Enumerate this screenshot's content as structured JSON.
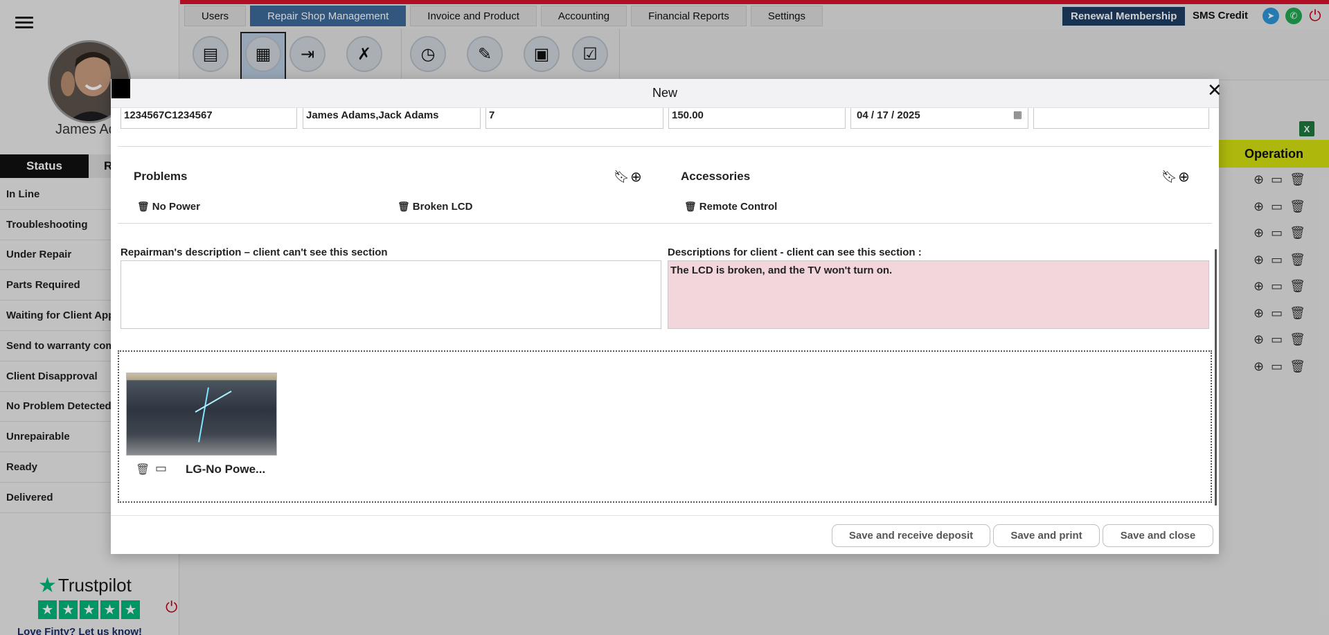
{
  "sidebar": {
    "user_name": "James Ada",
    "tabs": {
      "status": "Status",
      "other": "R"
    },
    "statuses": [
      "In Line",
      "Troubleshooting",
      "Under Repair",
      "Parts Required",
      "Waiting for Client App",
      "Send to warranty com",
      "Client Disapproval",
      "No Problem Detected",
      "Unrepairable",
      "Ready",
      "Delivered"
    ],
    "trustpilot": {
      "brand": "Trustpilot",
      "cta": "Love Finty? Let us know!"
    }
  },
  "nav": {
    "tabs": [
      "Users",
      "Repair Shop Management",
      "Invoice and Product",
      "Accounting",
      "Financial Reports",
      "Settings"
    ],
    "active": "Repair Shop Management",
    "renewal": "Renewal Membership",
    "sms_credit": "SMS Credit"
  },
  "table": {
    "operation_header": "Operation",
    "row_count": 8,
    "row_icons": [
      "add-circle-icon",
      "monitor-icon",
      "trash-icon"
    ]
  },
  "modal": {
    "title": "New",
    "fields": {
      "serial": "1234567C1234567",
      "client": "James Adams,Jack Adams",
      "count": "7",
      "price": "150.00",
      "date": "04 / 17 / 2025",
      "extra": ""
    },
    "problems": {
      "title": "Problems",
      "items": [
        "No Power",
        "Broken LCD"
      ]
    },
    "accessories": {
      "title": "Accessories",
      "items": [
        "Remote Control"
      ]
    },
    "repairman_desc": {
      "label": "Repairman's description – client can't see this section",
      "value": ""
    },
    "client_desc": {
      "label": "Descriptions for client - client can see this section :",
      "value": "The LCD is broken, and the TV won't turn on."
    },
    "attachment": {
      "name": "LG-No Powe..."
    },
    "buttons": {
      "save_deposit": "Save and receive deposit",
      "save_print": "Save and print",
      "save_close": "Save and close"
    }
  },
  "colors": {
    "nav_active": "#3e6b9b",
    "operation_header": "#d4e00f",
    "client_desc_bg": "#f2d6dc",
    "brand_red": "#d6122b"
  }
}
